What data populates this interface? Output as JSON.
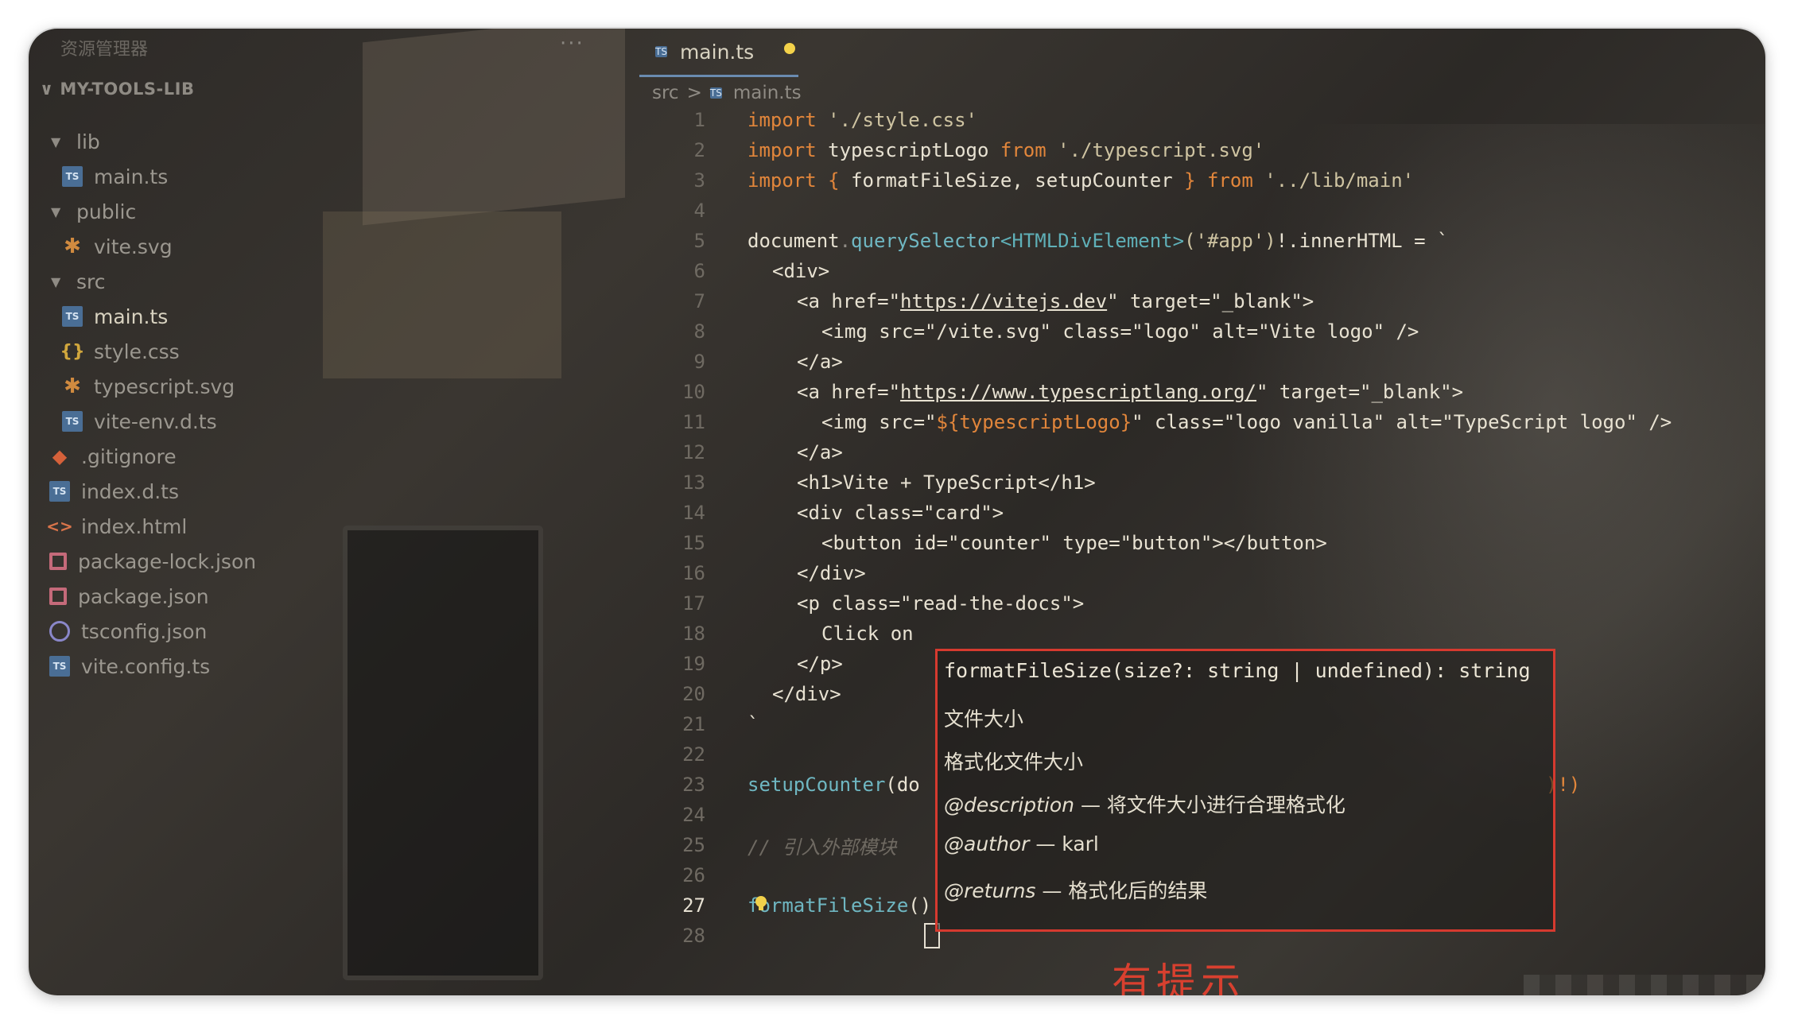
{
  "explorer": {
    "header": "资源管理器",
    "more": "···",
    "project": "MY-TOOLS-LIB",
    "items": [
      {
        "label": "lib",
        "type": "folder"
      },
      {
        "label": "main.ts",
        "type": "ts"
      },
      {
        "label": "public",
        "type": "folder"
      },
      {
        "label": "vite.svg",
        "type": "svg"
      },
      {
        "label": "src",
        "type": "folder"
      },
      {
        "label": "main.ts",
        "type": "ts"
      },
      {
        "label": "style.css",
        "type": "css"
      },
      {
        "label": "typescript.svg",
        "type": "svg"
      },
      {
        "label": "vite-env.d.ts",
        "type": "ts"
      },
      {
        "label": ".gitignore",
        "type": "git"
      },
      {
        "label": "index.d.ts",
        "type": "ts"
      },
      {
        "label": "index.html",
        "type": "html"
      },
      {
        "label": "package-lock.json",
        "type": "json"
      },
      {
        "label": "package.json",
        "type": "json"
      },
      {
        "label": "tsconfig.json",
        "type": "tsconfig"
      },
      {
        "label": "vite.config.ts",
        "type": "ts"
      }
    ]
  },
  "editor": {
    "tab": {
      "label": "main.ts",
      "icon": "TS"
    },
    "breadcrumb": {
      "folder": "src",
      "sep": ">",
      "file": "main.ts"
    },
    "line_numbers": [
      "1",
      "2",
      "3",
      "4",
      "5",
      "6",
      "7",
      "8",
      "9",
      "10",
      "11",
      "12",
      "13",
      "14",
      "15",
      "16",
      "17",
      "18",
      "19",
      "20",
      "21",
      "22",
      "23",
      "24",
      "25",
      "26",
      "27",
      "28"
    ],
    "lines": {
      "l1": {
        "kw": "import",
        "str": " './style.css'"
      },
      "l2": {
        "kw": "import",
        "id": " typescriptLogo ",
        "kw2": "from",
        "str": " './typescript.svg'"
      },
      "l3": {
        "kw": "import",
        "p1": " { ",
        "id": "formatFileSize, setupCounter",
        "p2": " } ",
        "kw2": "from",
        "str": " '../lib/main'"
      },
      "l5": {
        "obj": "document",
        "dot": ".",
        "fn": "querySelector",
        "typ": "<HTMLDivElement>",
        "arg": "('#app')",
        "rest": "!.innerHTML = `"
      },
      "l6": "<div>",
      "l7": {
        "a": "<a href=\"",
        "url": "https://vitejs.dev",
        "b": "\" target=\"_blank\">"
      },
      "l8": "<img src=\"/vite.svg\" class=\"logo\" alt=\"Vite logo\" />",
      "l9": "</a>",
      "l10": {
        "a": "<a href=\"",
        "url": "https://www.typescriptlang.org/",
        "b": "\" target=\"_blank\">"
      },
      "l11": {
        "a": "<img src=\"",
        "tpl": "${typescriptLogo}",
        "b": "\" class=\"logo vanilla\" alt=\"TypeScript logo\" />"
      },
      "l12": "</a>",
      "l13": "<h1>Vite + TypeScript</h1>",
      "l14": "<div class=\"card\">",
      "l15": "<button id=\"counter\" type=\"button\"></button>",
      "l16": "</div>",
      "l17": "<p class=\"read-the-docs\">",
      "l18": "Click on",
      "l19": "</p>",
      "l20": "</div>",
      "l21": "`",
      "l23": {
        "fn": "setupCounter",
        "rest": "(do",
        "tail": ")!)"
      },
      "l25": "// 引入外部模块",
      "l27": {
        "fn": "formatFileSize",
        "paren": "()"
      }
    }
  },
  "hover": {
    "signature": "formatFileSize(size?: string | undefined): string",
    "line1": "文件大小",
    "line2": "格式化文件大小",
    "desc_tag": "@description",
    "desc_text": " — 将文件大小进行合理格式化",
    "author_tag": "@author",
    "author_text": " — karl",
    "returns_tag": "@returns",
    "returns_text": " — 格式化后的结果"
  },
  "caption": "有提示",
  "colors": {
    "highlight_border": "#d63a2f",
    "keyword": "#e2863b",
    "accent": "#6a8bb0"
  }
}
